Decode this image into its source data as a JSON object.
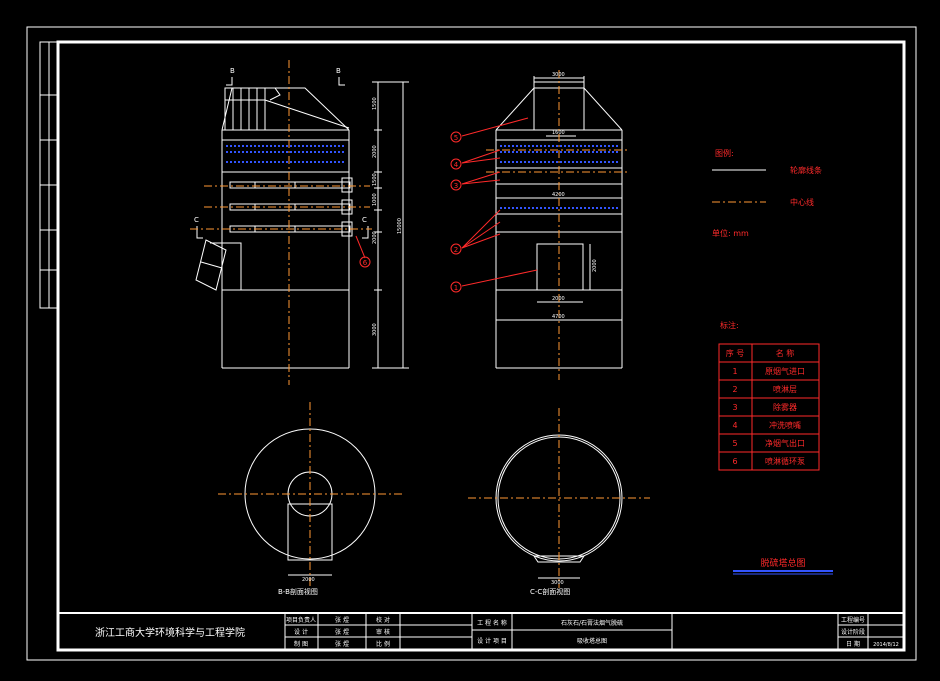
{
  "colors": {
    "background": "#000000",
    "line": "#ffffff",
    "red": "#ff2a2a",
    "center": "#ff9933",
    "spray": "#3355ff",
    "yellow": "#ffff40"
  },
  "elevation": {
    "left_markers": {
      "b1": "B",
      "b2": "B",
      "c1": "C",
      "c2": "C"
    },
    "right_dims": [
      "1500",
      "2000",
      "1500",
      "1000",
      "2000",
      "3000",
      "1500"
    ],
    "total_dim": "15000",
    "label_6": "6"
  },
  "section": {
    "top_dim": "3000",
    "inner_dim1": "1600",
    "inner_dim2": "4200",
    "bottom_dim": "4700",
    "inlet_dim": "2000",
    "inlet_h": "2000",
    "callouts": [
      "5",
      "4",
      "3",
      "2",
      "1"
    ]
  },
  "plans": {
    "bb_label": "B-B剖面视图",
    "cc_label": "C-C剖面视图",
    "bb_dim": "2000",
    "cc_dim": "3000"
  },
  "legend": {
    "title": "图例:",
    "items": [
      {
        "label": "轮廓线条",
        "style": "solid"
      },
      {
        "label": "中心线",
        "style": "dashed"
      }
    ],
    "unit": "单位: mm"
  },
  "parts": {
    "title": "标注:",
    "headers": [
      "序 号",
      "名 称"
    ],
    "rows": [
      {
        "no": "1",
        "name": "原烟气进口"
      },
      {
        "no": "2",
        "name": "喷淋层"
      },
      {
        "no": "3",
        "name": "除雾器"
      },
      {
        "no": "4",
        "name": "冲洗喷嘴"
      },
      {
        "no": "5",
        "name": "净烟气出口"
      },
      {
        "no": "6",
        "name": "喷淋循环泵"
      }
    ]
  },
  "drawing_title": "脱硫塔总图",
  "title_block": {
    "school": "浙江工商大学环境科学与工程学院",
    "roles": [
      "项目负责人",
      "设 计",
      "制 图"
    ],
    "names": [
      "张 煜",
      "张 煜",
      "张 煜"
    ],
    "checks": [
      "校 对",
      "审 核",
      "比 例"
    ],
    "project_labels": [
      "工 程 名 称",
      "设 计 项 目"
    ],
    "project_name": "石灰石/石膏法烟气脱硫",
    "design_item": "吸收塔总图",
    "right_labels": [
      "工程编号",
      "设计阶段",
      "日 期"
    ],
    "date": "2014/8/12"
  }
}
